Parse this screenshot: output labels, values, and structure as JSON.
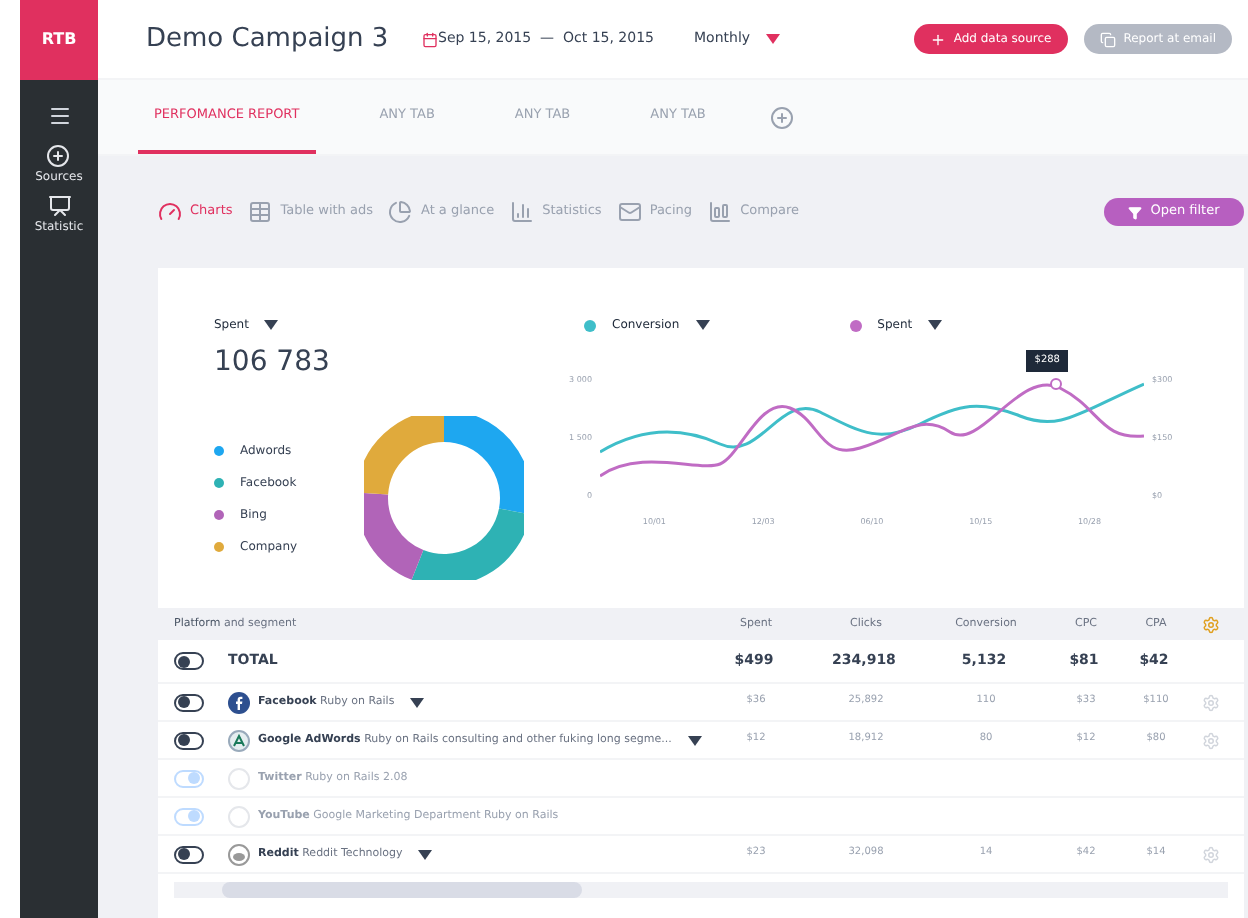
{
  "sidebar": {
    "logo": "RTB",
    "items": [
      {
        "label": "Sources",
        "kind": "sources"
      },
      {
        "label": "Statistic",
        "kind": "statistic"
      }
    ]
  },
  "header": {
    "title": "Demo Campaign 3",
    "date_range": "Sep 15, 2015  —  Oct 15, 2015",
    "period": "Monthly",
    "buttons": [
      {
        "label": "Add data source",
        "kind": "primary"
      },
      {
        "label": "Report at email",
        "kind": "secondary"
      }
    ]
  },
  "tabs": [
    {
      "label": "PERFOMANCE REPORT",
      "selected": true
    },
    {
      "label": "ANY TAB",
      "selected": false
    },
    {
      "label": "ANY TAB",
      "selected": false
    },
    {
      "label": "ANY TAB",
      "selected": false
    }
  ],
  "views": [
    {
      "label": "Charts",
      "kind": "charts",
      "selected": true
    },
    {
      "label": "Table with ads",
      "kind": "table",
      "selected": false
    },
    {
      "label": "At a glance",
      "kind": "glance",
      "selected": false
    },
    {
      "label": "Statistics",
      "kind": "stats",
      "selected": false
    },
    {
      "label": "Pacing",
      "kind": "pacing",
      "selected": false
    },
    {
      "label": "Compare",
      "kind": "compare",
      "selected": false
    }
  ],
  "filter_button": "Open filter",
  "summary": {
    "metric": "Spent",
    "value": "106 783",
    "legend": [
      {
        "label": "Adwords",
        "color": "#1ea7f0"
      },
      {
        "label": "Facebook",
        "color": "#2eb2b4"
      },
      {
        "label": "Bing",
        "color": "#b164b8"
      },
      {
        "label": "Company",
        "color": "#e0aa3c"
      }
    ]
  },
  "line_chart": {
    "series": [
      {
        "label": "Conversion",
        "color": "#3fbec9"
      },
      {
        "label": "Spent",
        "color": "#c06cc4"
      }
    ],
    "tooltip": "$288",
    "left_ticks": [
      "3 000",
      "1 500",
      "0"
    ],
    "right_ticks": [
      "$300",
      "$150",
      "$0"
    ],
    "x_labels": [
      "10/01",
      "12/03",
      "06/10",
      "10/15",
      "10/28"
    ]
  },
  "table": {
    "columns": [
      {
        "label": "Platform",
        "hint": "and segment"
      },
      {
        "label": "Spent"
      },
      {
        "label": "Clicks"
      },
      {
        "label": "Conversion"
      },
      {
        "label": "CPC"
      },
      {
        "label": "CPA"
      }
    ],
    "total": {
      "label": "TOTAL",
      "on": false,
      "values": [
        "$499",
        "234,918",
        "5,132",
        "$81",
        "$42"
      ]
    },
    "rows": [
      {
        "platform": "Facebook",
        "segment": "Ruby on Rails",
        "kind": "facebook",
        "disabled": false,
        "values": [
          "$36",
          "25,892",
          "110",
          "$33",
          "$110"
        ]
      },
      {
        "platform": "Google AdWords",
        "segment": "Ruby on Rails consulting and other fuking long segme...",
        "kind": "adwords",
        "disabled": false,
        "values": [
          "$12",
          "18,912",
          "80",
          "$12",
          "$80"
        ]
      },
      {
        "platform": "Twitter",
        "segment": "Ruby on Rails 2.08",
        "kind": "twitter",
        "disabled": true,
        "values": []
      },
      {
        "platform": "YouTube",
        "segment": "Google Marketing Department Ruby on Rails",
        "kind": "youtube",
        "disabled": true,
        "values": []
      },
      {
        "platform": "Reddit",
        "segment": "Reddit Technology",
        "kind": "reddit",
        "disabled": false,
        "values": [
          "$23",
          "32,098",
          "14",
          "$42",
          "$14"
        ]
      }
    ]
  }
}
